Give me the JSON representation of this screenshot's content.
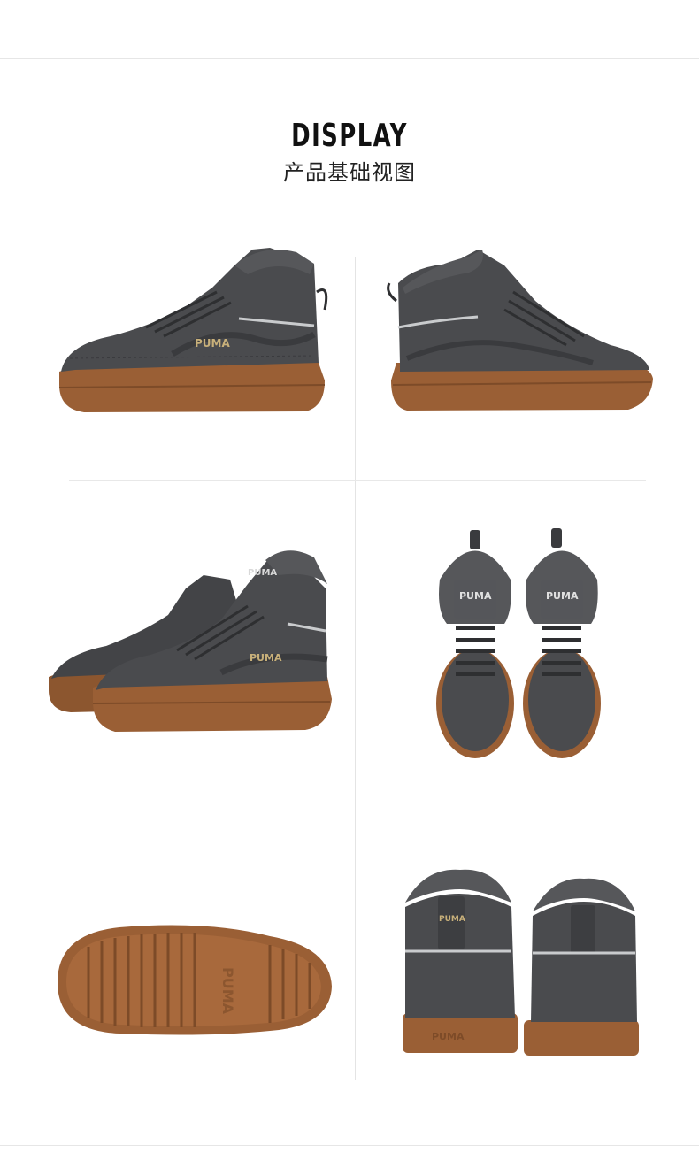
{
  "header": {
    "title": "DISPLAY",
    "subtitle": "产品基础视图"
  },
  "colors": {
    "upper": "#4a4b4e",
    "upper_dark": "#3a3b3e",
    "sole": "#9a5f35",
    "sole_dark": "#7d4b28",
    "fur": "#56575a",
    "logo_gold": "#c8b07a",
    "stripe": "#c9cbcd"
  },
  "images": [
    {
      "icon": "shoe-lateral-left-view"
    },
    {
      "icon": "shoe-medial-right-view"
    },
    {
      "icon": "shoe-pair-angled-view"
    },
    {
      "icon": "shoe-pair-top-view"
    },
    {
      "icon": "shoe-outsole-view"
    },
    {
      "icon": "shoe-pair-back-view"
    }
  ]
}
